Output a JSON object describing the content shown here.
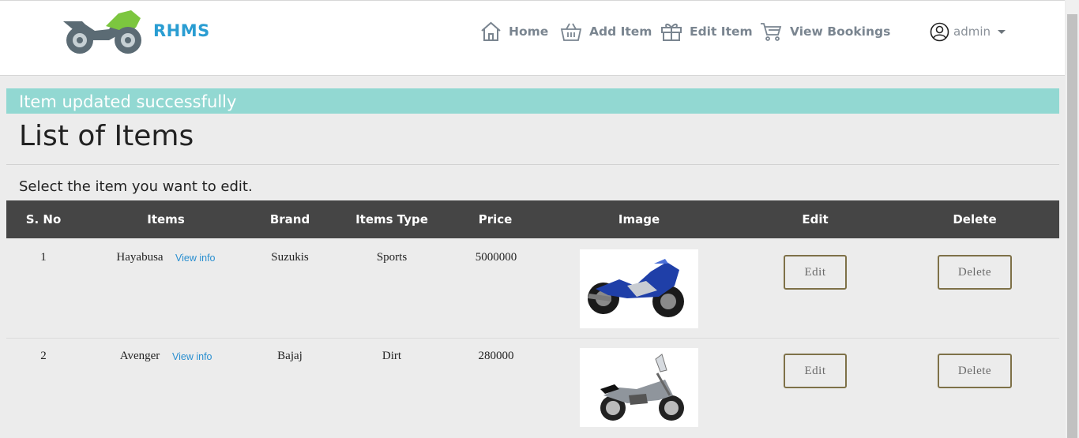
{
  "brand": {
    "name": "RHMS",
    "logo_icon": "motorcycle-icon"
  },
  "nav": [
    {
      "label": "Home",
      "icon": "home-icon"
    },
    {
      "label": "Add Item",
      "icon": "basket-icon"
    },
    {
      "label": "Edit Item",
      "icon": "gift-icon"
    },
    {
      "label": "View Bookings",
      "icon": "cart-icon"
    }
  ],
  "user": {
    "name": "admin",
    "icon": "user-circle-icon"
  },
  "alert": {
    "text": "Item updated successfully",
    "color": "#92d8d2"
  },
  "page": {
    "title": "List of Items",
    "subtitle": "Select the item you want to edit."
  },
  "table": {
    "headers": [
      "S. No",
      "Items",
      "Brand",
      "Items Type",
      "Price",
      "Image",
      "Edit",
      "Delete"
    ],
    "rows": [
      {
        "sno": "1",
        "item": "Hayabusa",
        "view_info": "View info",
        "brand": "Suzukis",
        "type": "Sports",
        "price": "5000000",
        "edit": "Edit",
        "delete": "Delete",
        "image_icon": "sport-motorcycle-photo"
      },
      {
        "sno": "2",
        "item": "Avenger",
        "view_info": "View info",
        "brand": "Bajaj",
        "type": "Dirt",
        "price": "280000",
        "edit": "Edit",
        "delete": "Delete",
        "image_icon": "cruiser-motorcycle-photo"
      }
    ]
  },
  "colors": {
    "brand": "#2a9dd2",
    "header_bg": "#454545",
    "link": "#2a8fd0",
    "button_border": "#7e7148"
  }
}
